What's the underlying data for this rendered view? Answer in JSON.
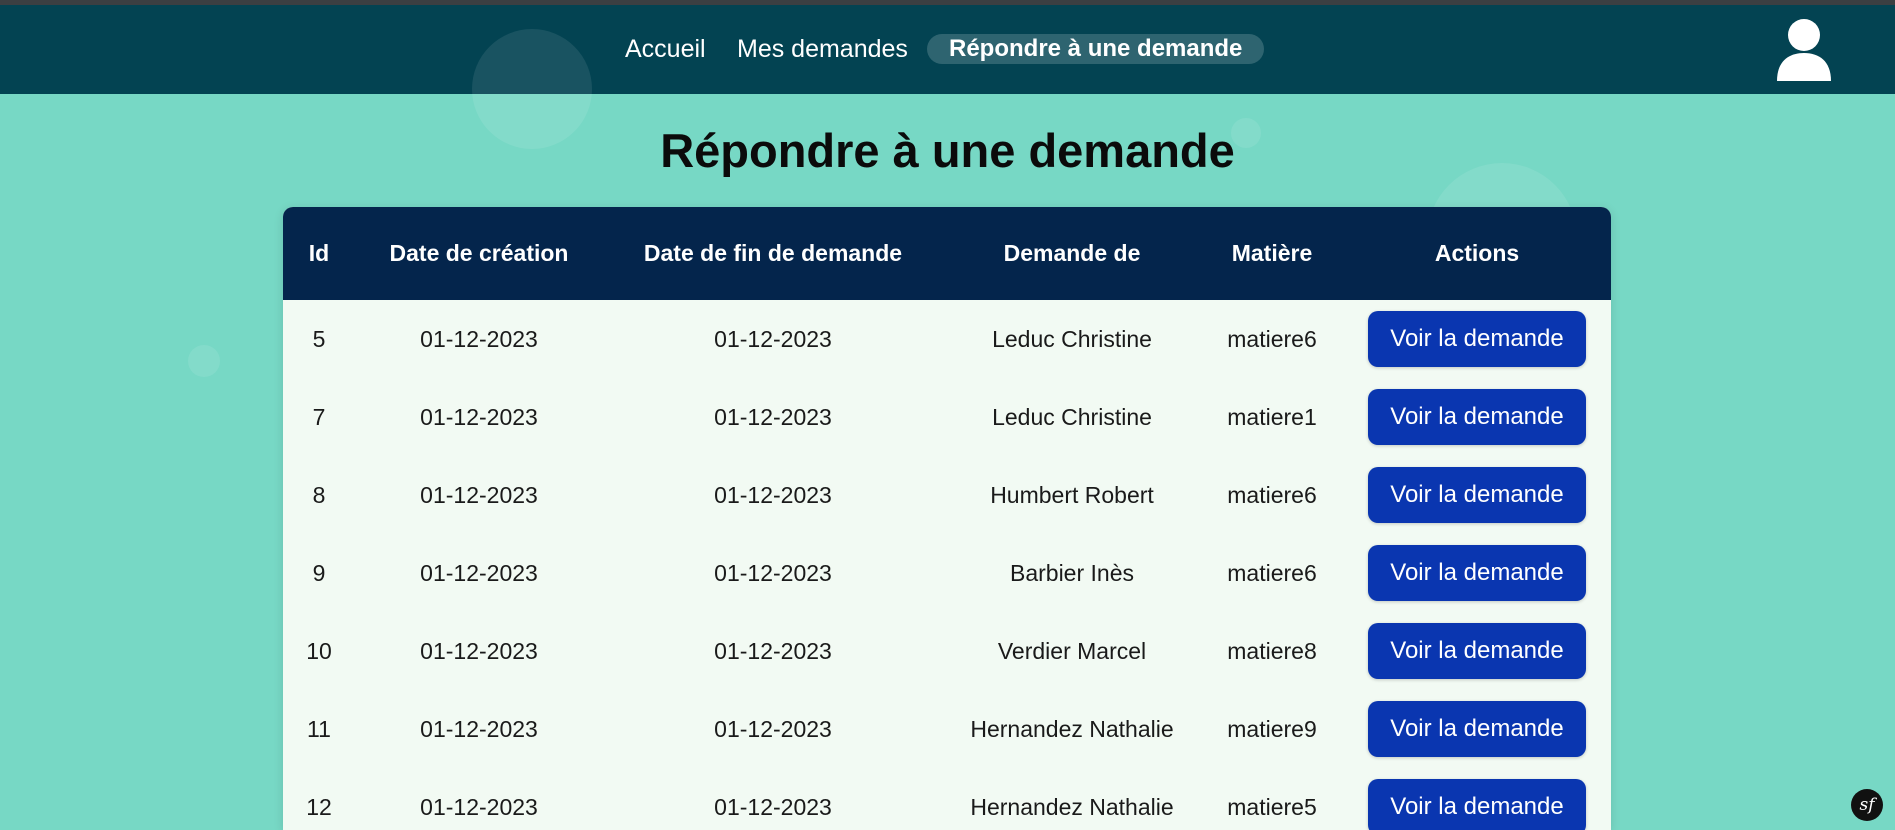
{
  "nav": {
    "links": [
      "Accueil",
      "Mes demandes"
    ],
    "active_link": "Répondre à une demande",
    "avatar_icon": "user-avatar-icon"
  },
  "page": {
    "title": "Répondre à une demande"
  },
  "table": {
    "headers": [
      "Id",
      "Date de création",
      "Date de fin de demande",
      "Demande de",
      "Matière",
      "Actions"
    ],
    "rows": [
      {
        "id": "5",
        "created": "01-12-2023",
        "end": "01-12-2023",
        "requester": "Leduc Christine",
        "subject": "matiere6",
        "action": "Voir la demande"
      },
      {
        "id": "7",
        "created": "01-12-2023",
        "end": "01-12-2023",
        "requester": "Leduc Christine",
        "subject": "matiere1",
        "action": "Voir la demande"
      },
      {
        "id": "8",
        "created": "01-12-2023",
        "end": "01-12-2023",
        "requester": "Humbert Robert",
        "subject": "matiere6",
        "action": "Voir la demande"
      },
      {
        "id": "9",
        "created": "01-12-2023",
        "end": "01-12-2023",
        "requester": "Barbier Inès",
        "subject": "matiere6",
        "action": "Voir la demande"
      },
      {
        "id": "10",
        "created": "01-12-2023",
        "end": "01-12-2023",
        "requester": "Verdier Marcel",
        "subject": "matiere8",
        "action": "Voir la demande"
      },
      {
        "id": "11",
        "created": "01-12-2023",
        "end": "01-12-2023",
        "requester": "Hernandez Nathalie",
        "subject": "matiere9",
        "action": "Voir la demande"
      },
      {
        "id": "12",
        "created": "01-12-2023",
        "end": "01-12-2023",
        "requester": "Hernandez Nathalie",
        "subject": "matiere5",
        "action": "Voir la demande"
      }
    ]
  },
  "footer": {
    "debug_icon": "symfony-icon",
    "debug_label": "sf"
  },
  "colors": {
    "background": "#77d8c5",
    "navbar": "#034352",
    "table_header": "#04254c",
    "button": "#0a36b0"
  }
}
